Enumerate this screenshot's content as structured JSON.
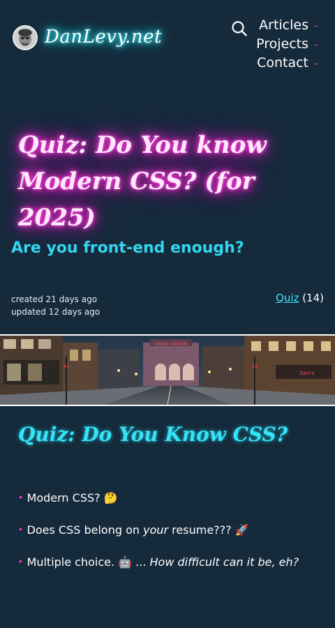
{
  "header": {
    "site_name": "DanLevy.net",
    "nav": [
      {
        "label": "Articles"
      },
      {
        "label": "Projects"
      },
      {
        "label": "Contact"
      }
    ]
  },
  "post": {
    "title_line1": "Quiz: Do You know",
    "title_line2": "Modern CSS? (for 2025)",
    "subtitle": "Are you front-end enough?",
    "created": "created 21 days ago",
    "updated": "updated 12 days ago",
    "tag_label": "Quiz",
    "tag_count": "(14)"
  },
  "content": {
    "section_title": "Quiz: Do You Know CSS?",
    "items": [
      {
        "text": "Modern CSS? 🤔"
      },
      {
        "before": "Does CSS belong on ",
        "em": "your",
        "after": " resume??? 🚀"
      },
      {
        "before": "Multiple choice. 🤖 ... ",
        "em": "How difficult can it be, eh?"
      }
    ]
  },
  "colors": {
    "background": "#152a3b",
    "title_glow": "#ff2fd8",
    "accent_cyan": "#33d6f0",
    "bullet_pink": "#ff3fc9"
  },
  "icons": {
    "search": "search-icon",
    "chevron": "chevron-down-icon",
    "avatar": "avatar"
  }
}
